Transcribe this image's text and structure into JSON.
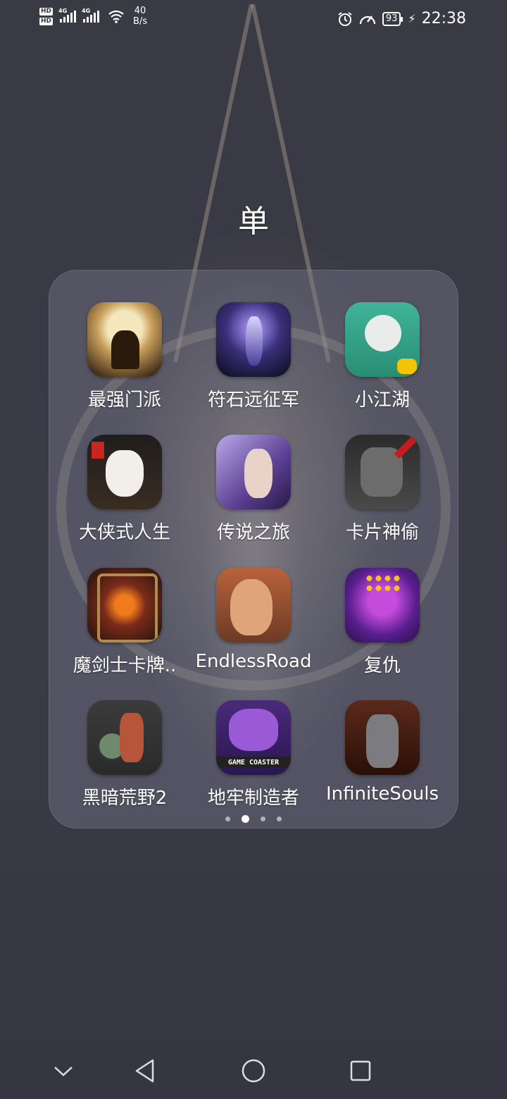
{
  "status_bar": {
    "hd1": "HD",
    "hd2": "HD",
    "network1": "4G",
    "network2": "4G",
    "speed_value": "40",
    "speed_unit": "B/s",
    "battery": "93",
    "time": "22:38",
    "icons": [
      "alarm-icon",
      "speedometer-icon",
      "charging-icon",
      "wifi-icon"
    ]
  },
  "folder": {
    "title": "单",
    "apps": [
      {
        "label": "最强门派",
        "icon": "zuiqiang-menpai-icon"
      },
      {
        "label": "符石远征军",
        "icon": "fushi-yuanzhengjun-icon"
      },
      {
        "label": "小江湖",
        "icon": "xiao-jianghu-icon"
      },
      {
        "label": "大侠式人生",
        "icon": "daxia-rensheng-icon"
      },
      {
        "label": "传说之旅",
        "icon": "chuanshuo-zhilv-icon"
      },
      {
        "label": "卡片神偷",
        "icon": "kapian-shentou-icon"
      },
      {
        "label": "魔剑士卡牌..",
        "icon": "mojianshi-kapai-icon"
      },
      {
        "label": "EndlessRoad",
        "icon": "endless-road-icon"
      },
      {
        "label": "复仇",
        "icon": "fuchou-icon"
      },
      {
        "label": "黑暗荒野2",
        "icon": "heian-huangye-2-icon"
      },
      {
        "label": "地牢制造者",
        "icon": "dilao-zhizaozhe-icon",
        "icon_text": "GAME COASTER"
      },
      {
        "label": "InfiniteSouls",
        "icon": "infinite-souls-icon"
      }
    ],
    "pages": {
      "count": 4,
      "active": 2
    }
  },
  "nav_bar": {
    "icons": [
      "chevron-down-icon",
      "back-icon",
      "home-icon",
      "recents-icon"
    ]
  }
}
